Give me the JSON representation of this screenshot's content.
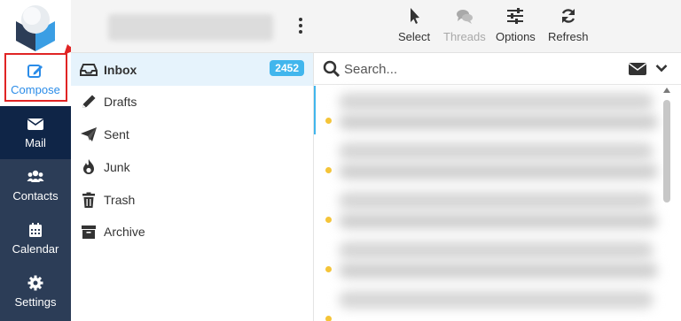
{
  "rail": {
    "compose_label": "Compose",
    "items": [
      {
        "label": "Mail",
        "icon": "envelope-icon"
      },
      {
        "label": "Contacts",
        "icon": "users-icon"
      },
      {
        "label": "Calendar",
        "icon": "calendar-icon"
      },
      {
        "label": "Settings",
        "icon": "gear-icon"
      }
    ],
    "active_item": "Mail",
    "compose_color": "#2b8ce8",
    "highlight_color": "#e02424"
  },
  "folders": {
    "items": [
      {
        "label": "Inbox",
        "icon": "inbox-icon",
        "count": "2452",
        "selected": true
      },
      {
        "label": "Drafts",
        "icon": "pencil-icon"
      },
      {
        "label": "Sent",
        "icon": "paper-plane-icon"
      },
      {
        "label": "Junk",
        "icon": "fire-icon"
      },
      {
        "label": "Trash",
        "icon": "trash-icon"
      },
      {
        "label": "Archive",
        "icon": "archive-box-icon"
      }
    ]
  },
  "toolbar": {
    "select": "Select",
    "threads": "Threads",
    "options": "Options",
    "refresh": "Refresh"
  },
  "search": {
    "placeholder": "Search..."
  }
}
